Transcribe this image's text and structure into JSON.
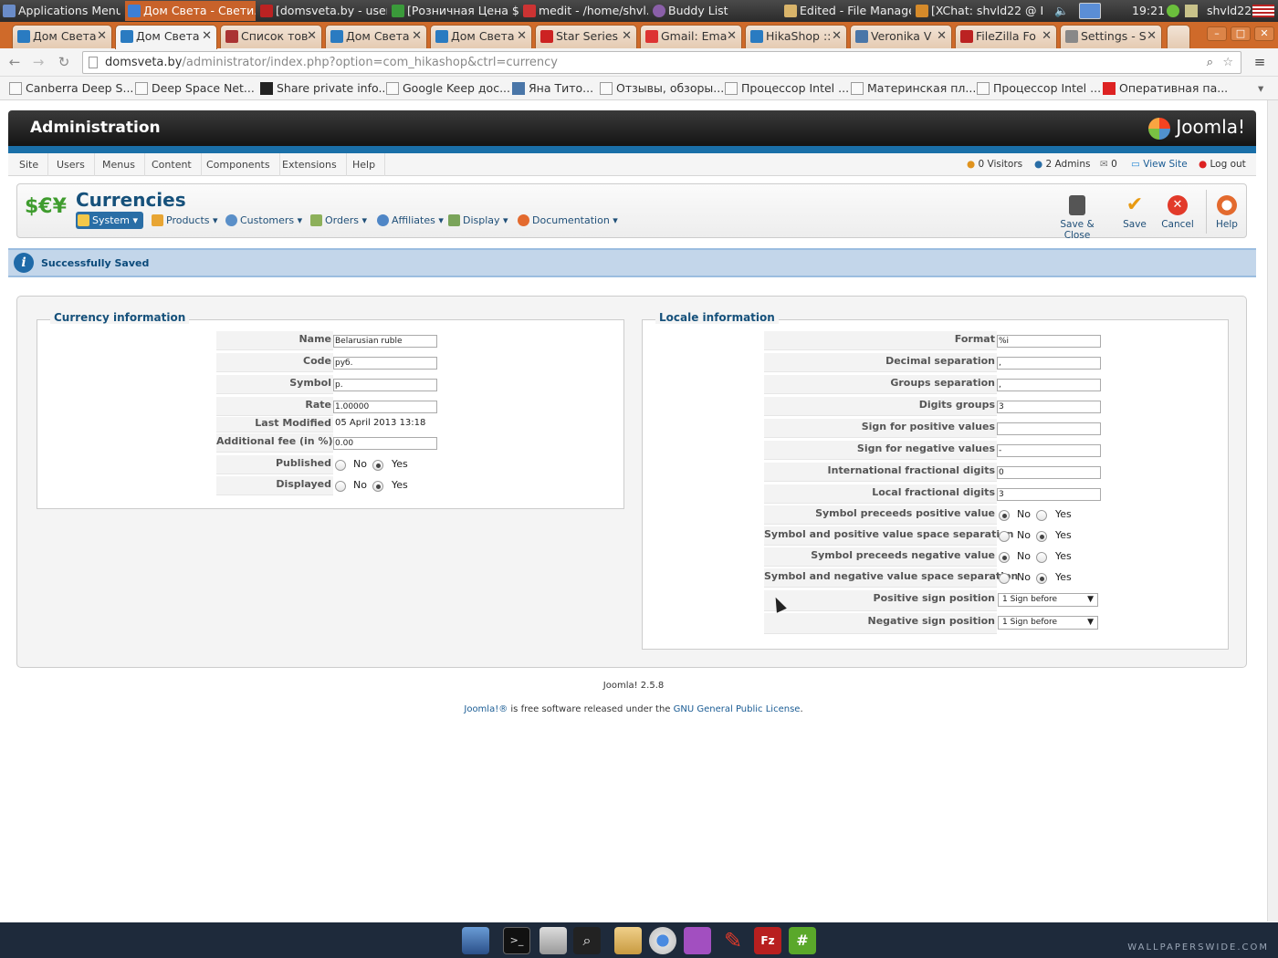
{
  "panel": {
    "apps_menu": "Applications Menu",
    "tasks": [
      "Дом Света - Свети...",
      "[domsveta.by - user...",
      "[Розничная Цена $...",
      "medit - /home/shvl...",
      "Buddy List",
      "Edited - File Manager",
      "[XChat: shvld22 @ B..."
    ],
    "clock": "19:21",
    "user": "shvld22"
  },
  "browser": {
    "tabs": [
      "Дом Света",
      "Дом Света",
      "Список тов",
      "Дом Света",
      "Дом Света",
      "Star Series",
      "Gmail: Ema",
      "HikaShop ::",
      "Veronika V",
      "FileZilla Fo",
      "Settings - S"
    ],
    "url_host": "domsveta.by",
    "url_path": "/administrator/index.php?option=com_hikashop&ctrl=currency",
    "bookmarks": [
      "Canberra Deep S...",
      "Deep Space Net...",
      "Share private info...",
      "Google Keep дос...",
      "Яна Тито...",
      "Отзывы, обзоры...",
      "Процессор Intel ...",
      "Материнская пл...",
      "Процессор Intel ...",
      "Оперативная па..."
    ]
  },
  "admin": {
    "header_title": "Administration",
    "logo": "Joomla!",
    "menu": [
      "Site",
      "Users",
      "Menus",
      "Content",
      "Components",
      "Extensions",
      "Help"
    ],
    "status": {
      "visitors": "0 Visitors",
      "admins": "2 Admins",
      "messages": "0",
      "view_site": "View Site",
      "logout": "Log out"
    },
    "page_title": "Currencies",
    "submenu": [
      "System",
      "Products",
      "Customers",
      "Orders",
      "Affiliates",
      "Display",
      "Documentation"
    ],
    "buttons": {
      "save_close": "Save & Close",
      "save": "Save",
      "cancel": "Cancel",
      "help": "Help"
    },
    "message": "Successfully Saved"
  },
  "currency": {
    "legend": "Currency information",
    "name_label": "Name",
    "name_value": "Belarusian ruble",
    "code_label": "Code",
    "code_value": "руб.",
    "symbol_label": "Symbol",
    "symbol_value": "р.",
    "rate_label": "Rate",
    "rate_value": "1.00000",
    "modified_label": "Last Modified",
    "modified_value": "05 April 2013 13:18",
    "fee_label": "Additional fee (in %)",
    "fee_value": "0.00",
    "published_label": "Published",
    "displayed_label": "Displayed",
    "no": "No",
    "yes": "Yes"
  },
  "locale": {
    "legend": "Locale information",
    "format_label": "Format",
    "format_value": "%i",
    "decimal_label": "Decimal separation",
    "decimal_value": ",",
    "groups_label": "Groups separation",
    "groups_value": ",",
    "digits_groups_label": "Digits groups",
    "digits_groups_value": "3",
    "pos_sign_label": "Sign for positive values",
    "pos_sign_value": "",
    "neg_sign_label": "Sign for negative values",
    "neg_sign_value": "-",
    "intl_frac_label": "International fractional digits",
    "intl_frac_value": "0",
    "local_frac_label": "Local fractional digits",
    "local_frac_value": "3",
    "sym_pre_pos_label": "Symbol preceeds positive value",
    "sym_space_pos_label": "Symbol and positive value space separation",
    "sym_pre_neg_label": "Symbol preceeds negative value",
    "sym_space_neg_label": "Symbol and negative value space separation",
    "pos_pos_label": "Positive sign position",
    "pos_pos_value": "1 Sign before",
    "neg_pos_label": "Negative sign position",
    "neg_pos_value": "1 Sign before"
  },
  "footer": {
    "version": "Joomla! 2.5.8",
    "license_link1": "Joomla!®",
    "license_text": " is free software released under the ",
    "license_link2": "GNU General Public License",
    "license_end": "."
  },
  "desktop": {
    "watermark": "WALLPAPERSWIDE.COM"
  }
}
